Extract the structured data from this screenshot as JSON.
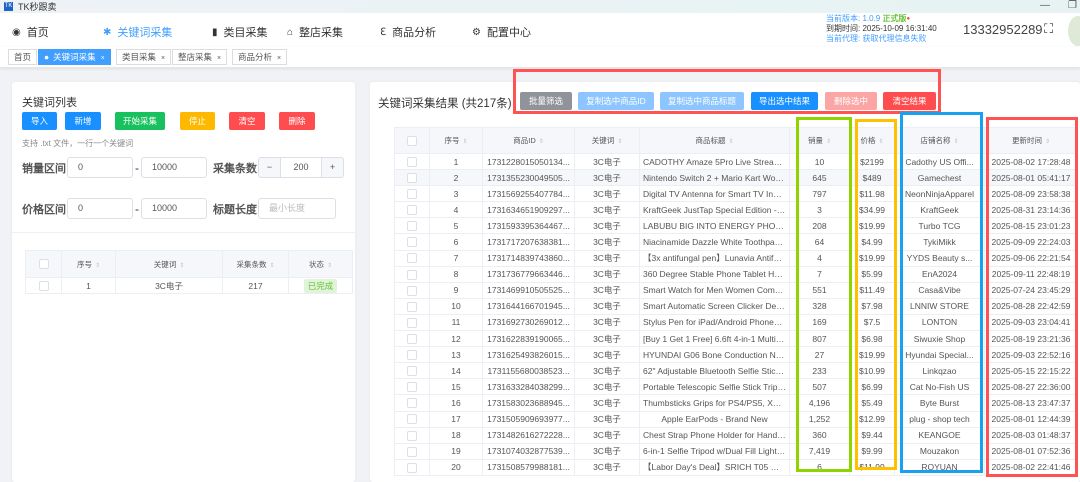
{
  "app": {
    "title": "TK秒跟卖",
    "logo": "TK"
  },
  "nav": [
    {
      "label": "首页",
      "icon": "dashboard-icon",
      "glyph": "◉"
    },
    {
      "label": "关键词采集",
      "icon": "bug-icon",
      "glyph": "✱"
    },
    {
      "label": "类目采集",
      "icon": "book-icon",
      "glyph": "▮"
    },
    {
      "label": "整店采集",
      "icon": "shop-icon",
      "glyph": "⌂"
    },
    {
      "label": "商品分析",
      "icon": "analysis-icon",
      "glyph": "ℇ"
    },
    {
      "label": "配置中心",
      "icon": "gear-icon",
      "glyph": "⚙"
    }
  ],
  "info": {
    "version_label": "当前版本: ",
    "version": "1.0.9",
    "release": "正式版",
    "expire": "到期时间: 2025-10-09 16:31:40",
    "agent_label": "当前代理: ",
    "agent": "获取代理信息失败",
    "phone": "13332952289"
  },
  "tabs": [
    {
      "label": "首页"
    },
    {
      "label": "关键词采集"
    },
    {
      "label": "类目采集"
    },
    {
      "label": "整店采集"
    },
    {
      "label": "商品分析"
    }
  ],
  "left": {
    "title": "关键词列表",
    "buttons": {
      "import": "导入",
      "add": "新增",
      "start": "开始采集",
      "stop": "停止",
      "clear": "清空",
      "delete": "删除"
    },
    "hint": "支持 .txt 文件，一行一个关键词",
    "sales_label": "销量区间",
    "sales_min": "0",
    "sales_max": "10000",
    "count_label": "采集条数",
    "count": "200",
    "price_label": "价格区间",
    "price_min": "0",
    "price_max": "10000",
    "title_len_label": "标题长度",
    "title_len_placeholder": "最小长度",
    "dash": "-",
    "table": {
      "headers": [
        "序号",
        "关键词",
        "采集条数",
        "状态"
      ],
      "rows": [
        [
          "1",
          "3C电子",
          "217",
          "已完成"
        ]
      ]
    }
  },
  "right": {
    "title": "关键词采集结果 (共217条)",
    "buttons": {
      "filter": "批量筛选",
      "copy_id": "复制选中商品ID",
      "copy_title": "复制选中商品标题",
      "export": "导出选中结果",
      "delete": "删除选中",
      "clear": "清空结果"
    },
    "headers": [
      "序号",
      "商品ID",
      "关键词",
      "商品标题",
      "销量",
      "价格",
      "店铺名称",
      "更新时间"
    ],
    "rows": [
      [
        "1",
        "1731228015050134...",
        "3C电子",
        "CADOTHY Amaze 5Pro Live Streamin...",
        "10",
        "$2199",
        "Cadothy US Offi...",
        "2025-08-02 17:28:48"
      ],
      [
        "2",
        "1731355230049505...",
        "3C电子",
        "Nintendo Switch 2 + Mario Kart World ...",
        "645",
        "$489",
        "Gamechest",
        "2025-08-01 05:41:17"
      ],
      [
        "3",
        "1731569255407784...",
        "3C电子",
        "Digital TV Antenna for Smart TV Indoor...",
        "797",
        "$11.98",
        "NeonNinjaApparel",
        "2025-08-09 23:58:38"
      ],
      [
        "4",
        "1731634651909297...",
        "3C电子",
        "KraftGeek JustTap Special Edition - Gr...",
        "3",
        "$34.99",
        "KraftGeek",
        "2025-08-31 23:14:36"
      ],
      [
        "5",
        "1731593395364467...",
        "3C电子",
        "LABUBU BIG INTO ENERGY PHONE ...",
        "208",
        "$19.99",
        "Turbo TCG",
        "2025-08-15 23:01:23"
      ],
      [
        "6",
        "1731717207638381...",
        "3C电子",
        "Niacinamide Dazzle White Toothpaste ...",
        "64",
        "$4.99",
        "TykiMikk",
        "2025-09-09 22:24:03"
      ],
      [
        "7",
        "1731714839743860...",
        "3C电子",
        "【3x antifungal pen】Lunavia Antifung...",
        "4",
        "$19.99",
        "YYDS Beauty s...",
        "2025-09-06 22:21:54"
      ],
      [
        "8",
        "1731736779663446...",
        "3C电子",
        "360 Degree Stable Phone Tablet Holde...",
        "7",
        "$5.99",
        "EnA2024",
        "2025-09-11 22:48:19"
      ],
      [
        "9",
        "1731469910505525...",
        "3C电子",
        "Smart Watch for Men Women Compati...",
        "551",
        "$11.49",
        "Casa&Vibe",
        "2025-07-24 23:45:29"
      ],
      [
        "10",
        "1731644166701945...",
        "3C电子",
        "Smart Automatic Screen Clicker Devic...",
        "328",
        "$7.98",
        "LNNIW STORE",
        "2025-08-28 22:42:59"
      ],
      [
        "11",
        "1731692730269012...",
        "3C电子",
        "Stylus Pen for iPad/Android Phones an...",
        "169",
        "$7.5",
        "LONTON",
        "2025-09-03 23:04:41"
      ],
      [
        "12",
        "1731622839190065...",
        "3C电子",
        "[Buy 1 Get 1 Free] 6.6ft 4-in-1 Multi us...",
        "807",
        "$6.98",
        "Siwuxie Shop",
        "2025-08-19 23:21:36"
      ],
      [
        "13",
        "1731625493826015...",
        "3C电子",
        "HYUNDAI G06 Bone Conduction Neck...",
        "27",
        "$19.99",
        "Hyundai Special...",
        "2025-09-03 22:52:16"
      ],
      [
        "14",
        "1731155680038523...",
        "3C电子",
        "62\" Adjustable Bluetooth Selfie Stick Tr...",
        "233",
        "$10.99",
        "Linkqzao",
        "2025-05-15 22:15:22"
      ],
      [
        "15",
        "1731633284038299...",
        "3C电子",
        "Portable Telescopic Selfie Stick Tripod ...",
        "507",
        "$6.99",
        "Cat No-Fish US",
        "2025-08-27 22:36:00"
      ],
      [
        "16",
        "1731583023688945...",
        "3C电子",
        "Thumbsticks Grips for PS4/PS5, XBOX...",
        "4,196",
        "$5.49",
        "Byte Burst",
        "2025-08-13 23:47:37"
      ],
      [
        "17",
        "1731505909693977...",
        "3C电子",
        "Apple EarPods - Brand New",
        "1,252",
        "$12.99",
        "plug - shop tech",
        "2025-08-01 12:44:39"
      ],
      [
        "18",
        "1731482616272228...",
        "3C电子",
        "Chest Strap Phone Holder for Hands-F...",
        "360",
        "$9.44",
        "KEANGOE",
        "2025-08-03 01:48:37"
      ],
      [
        "19",
        "1731074032877539...",
        "3C电子",
        "6-in-1 Selfie Tripod w/Dual Fill Lights &...",
        "7,419",
        "$9.99",
        "Mouzakon",
        "2025-08-01 07:52:36"
      ],
      [
        "20",
        "1731508579988181...",
        "3C电子",
        "【Labor Day's Deal】SRICH T05 Wirel...",
        "6",
        "$11.99",
        "RQYUAN",
        "2025-08-02 22:41:46"
      ]
    ]
  },
  "colors": {
    "accent": "#409eff",
    "success": "#19c15e",
    "warning": "#ffb800",
    "danger": "#ff4d4f",
    "annotation_red": "#ff5252",
    "annotation_green": "#8fd400",
    "annotation_orange": "#ffc000",
    "annotation_blue": "#1aa0f0"
  }
}
